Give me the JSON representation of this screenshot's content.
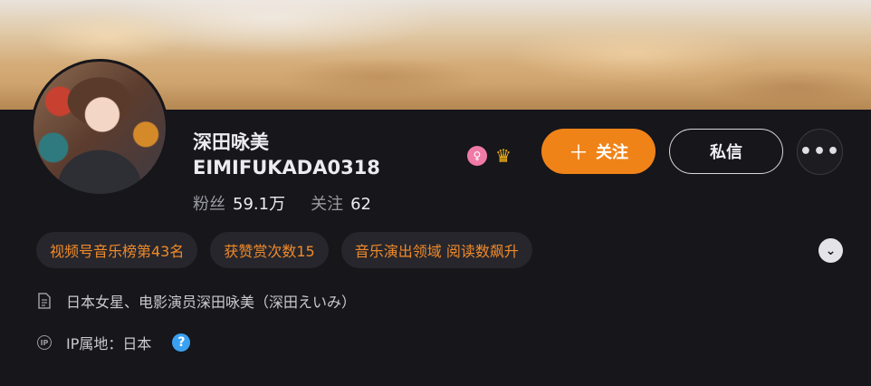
{
  "profile": {
    "name_line1": "深田咏美",
    "name_line2": "EIMIFUKADA0318",
    "fans_label": "粉丝",
    "fans_value": "59.1万",
    "following_label": "关注",
    "following_value": "62"
  },
  "badges": [
    {
      "icon": "pink-female-badge-icon"
    },
    {
      "icon": "crown-badge-icon"
    }
  ],
  "actions": {
    "follow_label": "关注",
    "message_label": "私信",
    "more_label": "•••"
  },
  "tags": [
    "视频号音乐榜第43名",
    "获赞赏次数15",
    "音乐演出领域 阅读数飙升"
  ],
  "bio": "日本女星、电影演员深田咏美（深田えいみ）",
  "ip": {
    "label": "IP属地：日本"
  },
  "colors": {
    "accent": "#f08318",
    "tag_text": "#f08a2a",
    "background": "#16161b",
    "help": "#3aa0f0"
  }
}
